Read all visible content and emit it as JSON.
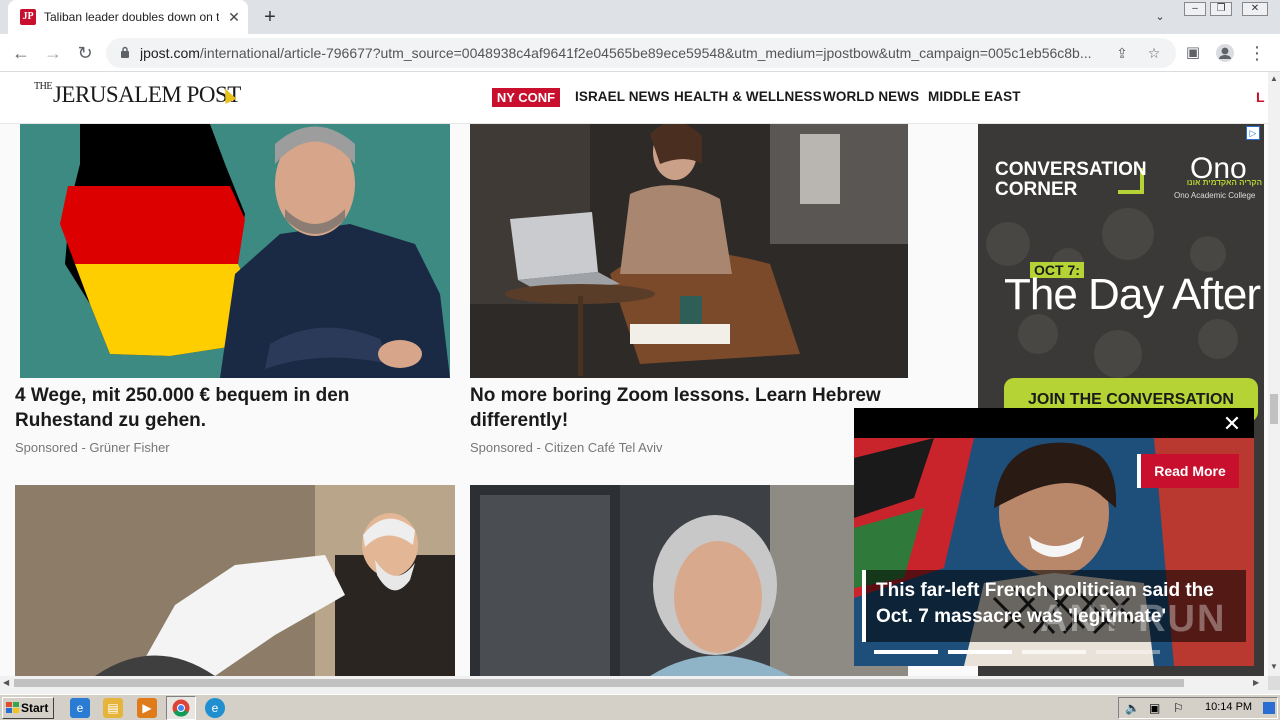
{
  "browser": {
    "tab_title": "Taliban leader doubles down on treat",
    "tab_favicon": "JP",
    "url_domain": "jpost.com",
    "url_path": "/international/article-796677?utm_source=0048938c4af9641f2e04565be89ece59548&utm_medium=jpostbow&utm_campaign=005c1eb56c8b...",
    "icons": {
      "back": "back-arrow-icon",
      "forward": "forward-arrow-icon",
      "reload": "reload-icon",
      "lock": "lock-icon",
      "share": "share-icon",
      "bookmark": "star-icon",
      "sidebar": "sidebar-icon",
      "profile": "profile-icon",
      "menu": "kebab-menu-icon"
    }
  },
  "site": {
    "logo_the": "THE",
    "logo_main": "JERUSALEM POST",
    "nav": [
      "NY CONF",
      "ISRAEL NEWS",
      "HEALTH & WELLNESS",
      "WORLD NEWS",
      "MIDDLE EAST"
    ],
    "nav_edge": "L",
    "brand_color": "#c8102e"
  },
  "cards": [
    {
      "title": "4 Wege, mit 250.000 € bequem in den Ruhestand zu gehen.",
      "sponsor": "Sponsored - Grüner Fisher"
    },
    {
      "title": "No more boring Zoom lessons. Learn Hebrew differently!",
      "sponsor": "Sponsored - Citizen Café Tel Aviv"
    }
  ],
  "ad": {
    "line1": "CONVERSATION",
    "line2": "CORNER",
    "brand": "Ono",
    "brand_hebrew": "הקריה האקדמית אונו",
    "brand_sub": "Ono Academic College",
    "tag": "OCT 7:",
    "headline": "The Day After",
    "cta": "JOIN THE CONVERSATION",
    "choice": "▷"
  },
  "video": {
    "read_more": "Read More",
    "caption": "This far-left French politician said the Oct. 7 massacre was 'legitimate'",
    "watermark": "ANY RUN"
  },
  "taskbar": {
    "start": "Start",
    "clock": "10:14 PM"
  }
}
